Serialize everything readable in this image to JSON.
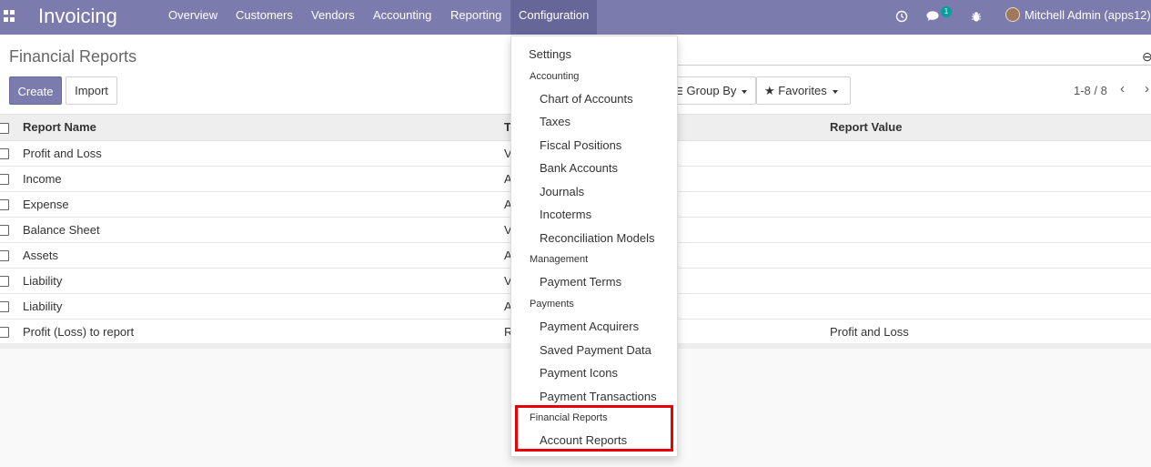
{
  "navbar": {
    "brand": "Invoicing",
    "menu": [
      "Overview",
      "Customers",
      "Vendors",
      "Accounting",
      "Reporting",
      "Configuration"
    ],
    "active_menu": "Configuration",
    "chat_badge": "1",
    "user": "Mitchell Admin (apps12)"
  },
  "control_panel": {
    "title": "Financial Reports",
    "create_label": "Create",
    "import_label": "Import",
    "group_by_label": "Group By",
    "favorites_label": "Favorites",
    "pager": "1-8 / 8"
  },
  "table": {
    "columns": [
      "Report Name",
      "T",
      "Report Value"
    ],
    "rows": [
      {
        "name": "Profit and Loss",
        "type": "V",
        "value": ""
      },
      {
        "name": "Income",
        "type": "A",
        "value": ""
      },
      {
        "name": "Expense",
        "type": "A",
        "value": ""
      },
      {
        "name": "Balance Sheet",
        "type": "V",
        "value": ""
      },
      {
        "name": "Assets",
        "type": "A",
        "value": ""
      },
      {
        "name": "Liability",
        "type": "V",
        "value": ""
      },
      {
        "name": "Liability",
        "type": "A",
        "value": ""
      },
      {
        "name": "Profit (Loss) to report",
        "type": "R",
        "value": "Profit and Loss"
      }
    ]
  },
  "dropdown": {
    "settings": "Settings",
    "section_accounting": "Accounting",
    "accounting_items": [
      "Chart of Accounts",
      "Taxes",
      "Fiscal Positions",
      "Bank Accounts",
      "Journals",
      "Incoterms",
      "Reconciliation Models"
    ],
    "section_management": "Management",
    "management_items": [
      "Payment Terms"
    ],
    "section_payments": "Payments",
    "payments_items": [
      "Payment Acquirers",
      "Saved Payment Data",
      "Payment Icons",
      "Payment Transactions"
    ],
    "section_financial_reports": "Financial Reports",
    "financial_reports_items": [
      "Account Reports"
    ]
  },
  "colors": {
    "navbar": "#7c7bad",
    "navbar_active": "#676699",
    "highlight": "#e8000b",
    "badge": "#00a09d"
  }
}
